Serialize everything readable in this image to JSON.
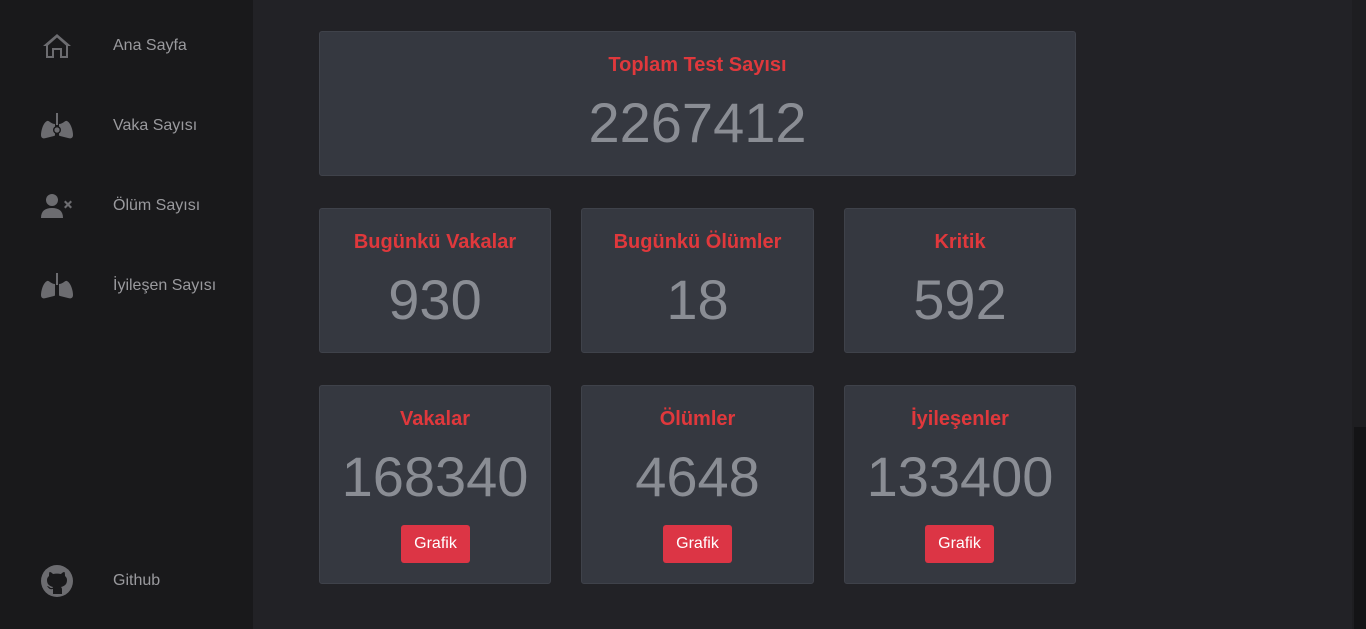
{
  "sidebar": {
    "items": [
      {
        "label": "Ana Sayfa",
        "icon": "home-icon"
      },
      {
        "label": "Vaka Sayısı",
        "icon": "lungs-virus-icon"
      },
      {
        "label": "Ölüm Sayısı",
        "icon": "user-times-icon"
      },
      {
        "label": "İyileşen Sayısı",
        "icon": "lungs-icon"
      }
    ],
    "footer": {
      "label": "Github",
      "icon": "github-icon"
    }
  },
  "colors": {
    "accent": "#e0383c",
    "button": "#dc3545",
    "card": "#353840",
    "background": "#222226",
    "sidebar": "#19191b"
  },
  "stats": {
    "total_tests": {
      "title": "Toplam Test Sayısı",
      "value": "2267412"
    },
    "today_cases": {
      "title": "Bugünkü Vakalar",
      "value": "930"
    },
    "today_deaths": {
      "title": "Bugünkü Ölümler",
      "value": "18"
    },
    "critical": {
      "title": "Kritik",
      "value": "592"
    },
    "cases": {
      "title": "Vakalar",
      "value": "168340",
      "button": "Grafik"
    },
    "deaths": {
      "title": "Ölümler",
      "value": "4648",
      "button": "Grafik"
    },
    "recovered": {
      "title": "İyileşenler",
      "value": "133400",
      "button": "Grafik"
    }
  }
}
